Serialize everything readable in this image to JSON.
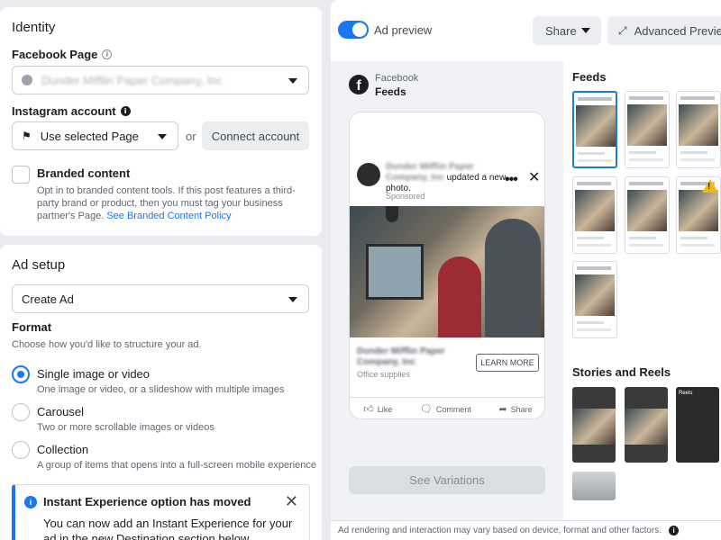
{
  "identity": {
    "title": "Identity",
    "facebook_page_label": "Facebook Page",
    "facebook_page_value": "Dunder Mifflin Paper Company, Inc",
    "instagram_label": "Instagram account",
    "instagram_select_value": "Use selected Page",
    "or_text": "or",
    "connect_button": "Connect account",
    "branded_title": "Branded content",
    "branded_desc": "Opt in to branded content tools. If this post features a third-party brand or product, then you must tag your business partner's Page.",
    "branded_link": "See Branded Content Policy"
  },
  "ad_setup": {
    "title": "Ad setup",
    "select_value": "Create Ad",
    "format_label": "Format",
    "format_desc": "Choose how you'd like to structure your ad.",
    "options": [
      {
        "title": "Single image or video",
        "desc": "One image or video, or a slideshow with multiple images",
        "selected": true
      },
      {
        "title": "Carousel",
        "desc": "Two or more scrollable images or videos",
        "selected": false
      },
      {
        "title": "Collection",
        "desc": "A group of items that opens into a full-screen mobile experience",
        "selected": false
      }
    ]
  },
  "notice": {
    "title": "Instant Experience option has moved",
    "body": "You can now add an Instant Experience for your ad in the new Destination section below."
  },
  "preview": {
    "toggle_on": true,
    "label": "Ad preview",
    "share_button": "Share",
    "advanced_button": "Advanced Preview",
    "platform": "Facebook",
    "placement": "Feeds",
    "post": {
      "page_name": "Dunder Mifflin Paper Company, Inc",
      "update_text": "updated a new photo.",
      "sponsored": "Sponsored",
      "cta_title": "Dunder Mifflin Paper Company, Inc",
      "cta_sub": "Office supplies",
      "cta_button": "LEARN MORE",
      "like": "Like",
      "comment": "Comment",
      "share": "Share"
    },
    "variations_button": "See Variations",
    "feeds_title": "Feeds",
    "stories_title": "Stories and Reels",
    "stories_reel_label": "Reels",
    "disclaimer": "Ad rendering and interaction may vary based on device, format and other factors."
  },
  "icons": {
    "brand": "#1877f2",
    "warning": "#f5b800"
  }
}
